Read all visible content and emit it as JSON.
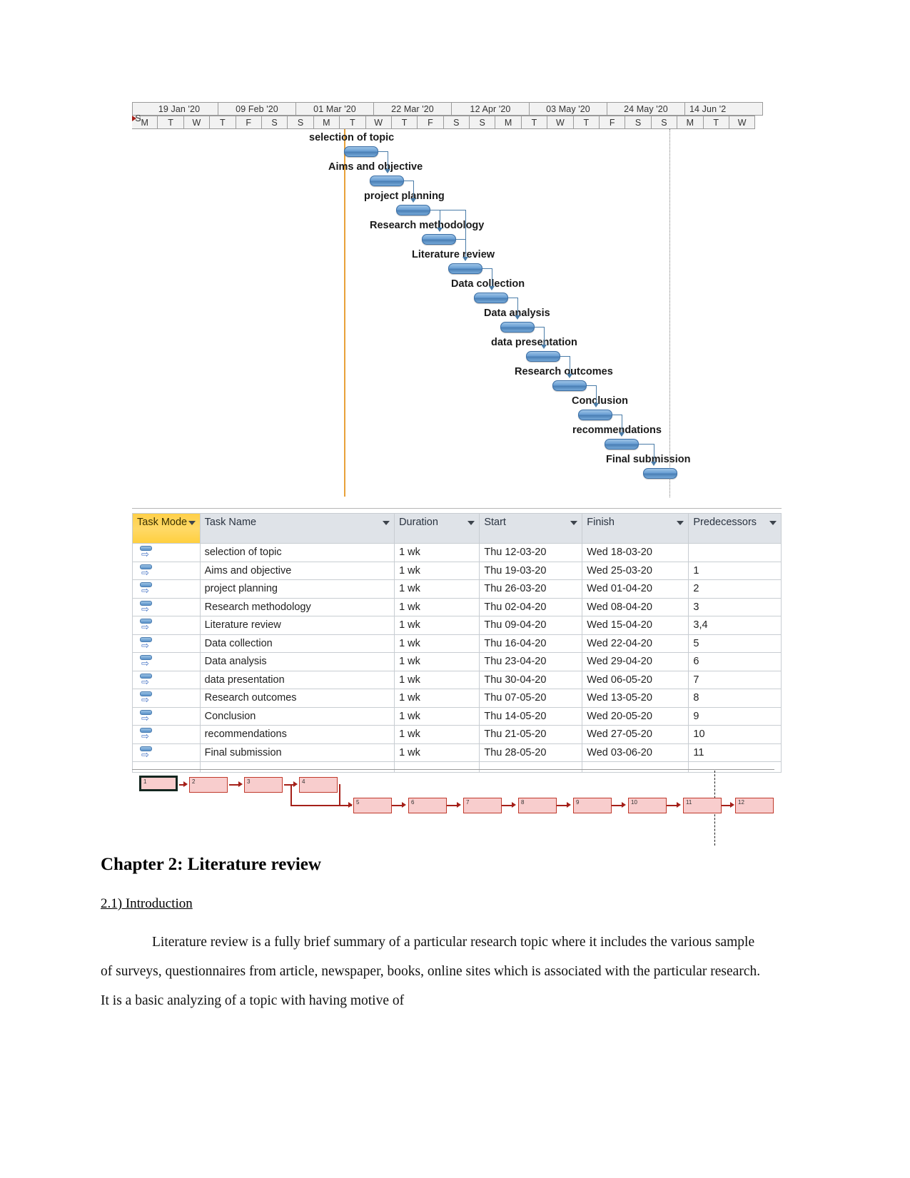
{
  "gantt": {
    "timescale": {
      "top_lead": "",
      "top_periods": [
        "19 Jan '20",
        "09 Feb '20",
        "01 Mar '20",
        "22 Mar '20",
        "12 Apr '20",
        "03 May '20",
        "24 May '20",
        "14 Jun '2"
      ],
      "bottom_lead": "S",
      "bottom_days": [
        "M",
        "T",
        "W",
        "T",
        "F",
        "S",
        "S",
        "M",
        "T",
        "W",
        "T",
        "F",
        "S",
        "S",
        "M",
        "T",
        "W",
        "T",
        "F",
        "S",
        "S",
        "M",
        "T",
        "W"
      ]
    },
    "tasks": [
      {
        "label": "selection of topic"
      },
      {
        "label": "Aims and objective"
      },
      {
        "label": "project planning"
      },
      {
        "label": "Research methodology"
      },
      {
        "label": "Literature review"
      },
      {
        "label": "Data collection"
      },
      {
        "label": "Data analysis"
      },
      {
        "label": "data presentation"
      },
      {
        "label": "Research outcomes"
      },
      {
        "label": "Conclusion"
      },
      {
        "label": "recommendations"
      },
      {
        "label": "Final submission"
      }
    ]
  },
  "table": {
    "headers": {
      "task_mode": "Task Mode",
      "task_name": "Task Name",
      "duration": "Duration",
      "start": "Start",
      "finish": "Finish",
      "predecessors": "Predecessors"
    },
    "rows": [
      {
        "mode_icon": "manually-scheduled-icon",
        "name": "selection of topic",
        "duration": "1 wk",
        "start": "Thu 12-03-20",
        "finish": "Wed 18-03-20",
        "predecessors": ""
      },
      {
        "mode_icon": "manually-scheduled-icon",
        "name": "Aims and objective",
        "duration": "1 wk",
        "start": "Thu 19-03-20",
        "finish": "Wed 25-03-20",
        "predecessors": "1"
      },
      {
        "mode_icon": "manually-scheduled-icon",
        "name": "project planning",
        "duration": "1 wk",
        "start": "Thu 26-03-20",
        "finish": "Wed 01-04-20",
        "predecessors": "2"
      },
      {
        "mode_icon": "manually-scheduled-icon",
        "name": "Research methodology",
        "duration": "1 wk",
        "start": "Thu 02-04-20",
        "finish": "Wed 08-04-20",
        "predecessors": "3"
      },
      {
        "mode_icon": "manually-scheduled-icon",
        "name": "Literature review",
        "duration": "1 wk",
        "start": "Thu 09-04-20",
        "finish": "Wed 15-04-20",
        "predecessors": "3,4"
      },
      {
        "mode_icon": "manually-scheduled-icon",
        "name": "Data collection",
        "duration": "1 wk",
        "start": "Thu 16-04-20",
        "finish": "Wed 22-04-20",
        "predecessors": "5"
      },
      {
        "mode_icon": "manually-scheduled-icon",
        "name": "Data analysis",
        "duration": "1 wk",
        "start": "Thu 23-04-20",
        "finish": "Wed 29-04-20",
        "predecessors": "6"
      },
      {
        "mode_icon": "manually-scheduled-icon",
        "name": "data presentation",
        "duration": "1 wk",
        "start": "Thu 30-04-20",
        "finish": "Wed 06-05-20",
        "predecessors": "7"
      },
      {
        "mode_icon": "manually-scheduled-icon",
        "name": "Research outcomes",
        "duration": "1 wk",
        "start": "Thu 07-05-20",
        "finish": "Wed 13-05-20",
        "predecessors": "8"
      },
      {
        "mode_icon": "manually-scheduled-icon",
        "name": "Conclusion",
        "duration": "1 wk",
        "start": "Thu 14-05-20",
        "finish": "Wed 20-05-20",
        "predecessors": "9"
      },
      {
        "mode_icon": "manually-scheduled-icon",
        "name": "recommendations",
        "duration": "1 wk",
        "start": "Thu 21-05-20",
        "finish": "Wed 27-05-20",
        "predecessors": "10"
      },
      {
        "mode_icon": "manually-scheduled-icon",
        "name": "Final submission",
        "duration": "1 wk",
        "start": "Thu 28-05-20",
        "finish": "Wed 03-06-20",
        "predecessors": "11"
      }
    ]
  },
  "network": {
    "nodes_row1": [
      "1",
      "2",
      "3",
      "4"
    ],
    "nodes_row2": [
      "5",
      "6",
      "7",
      "8",
      "9",
      "10",
      "11",
      "12"
    ]
  },
  "document": {
    "chapter_title": "Chapter 2: Literature review",
    "section_heading": "2.1) Introduction ",
    "paragraph": "Literature review is a fully brief summary of a particular research topic where it includes the various sample of surveys, questionnaires from article, newspaper, books, online sites which is associated with the particular research. It is a basic analyzing of a topic with having motive of"
  },
  "colors": {
    "bar_fill": "#6a9fd4",
    "bar_border": "#3a6ea5",
    "task_mode_header": "#ffd04a",
    "header_bg": "#dfe3e8",
    "node_fill": "#f8cdcd",
    "node_border": "#c0392b",
    "today_line": "#e8a13a"
  }
}
